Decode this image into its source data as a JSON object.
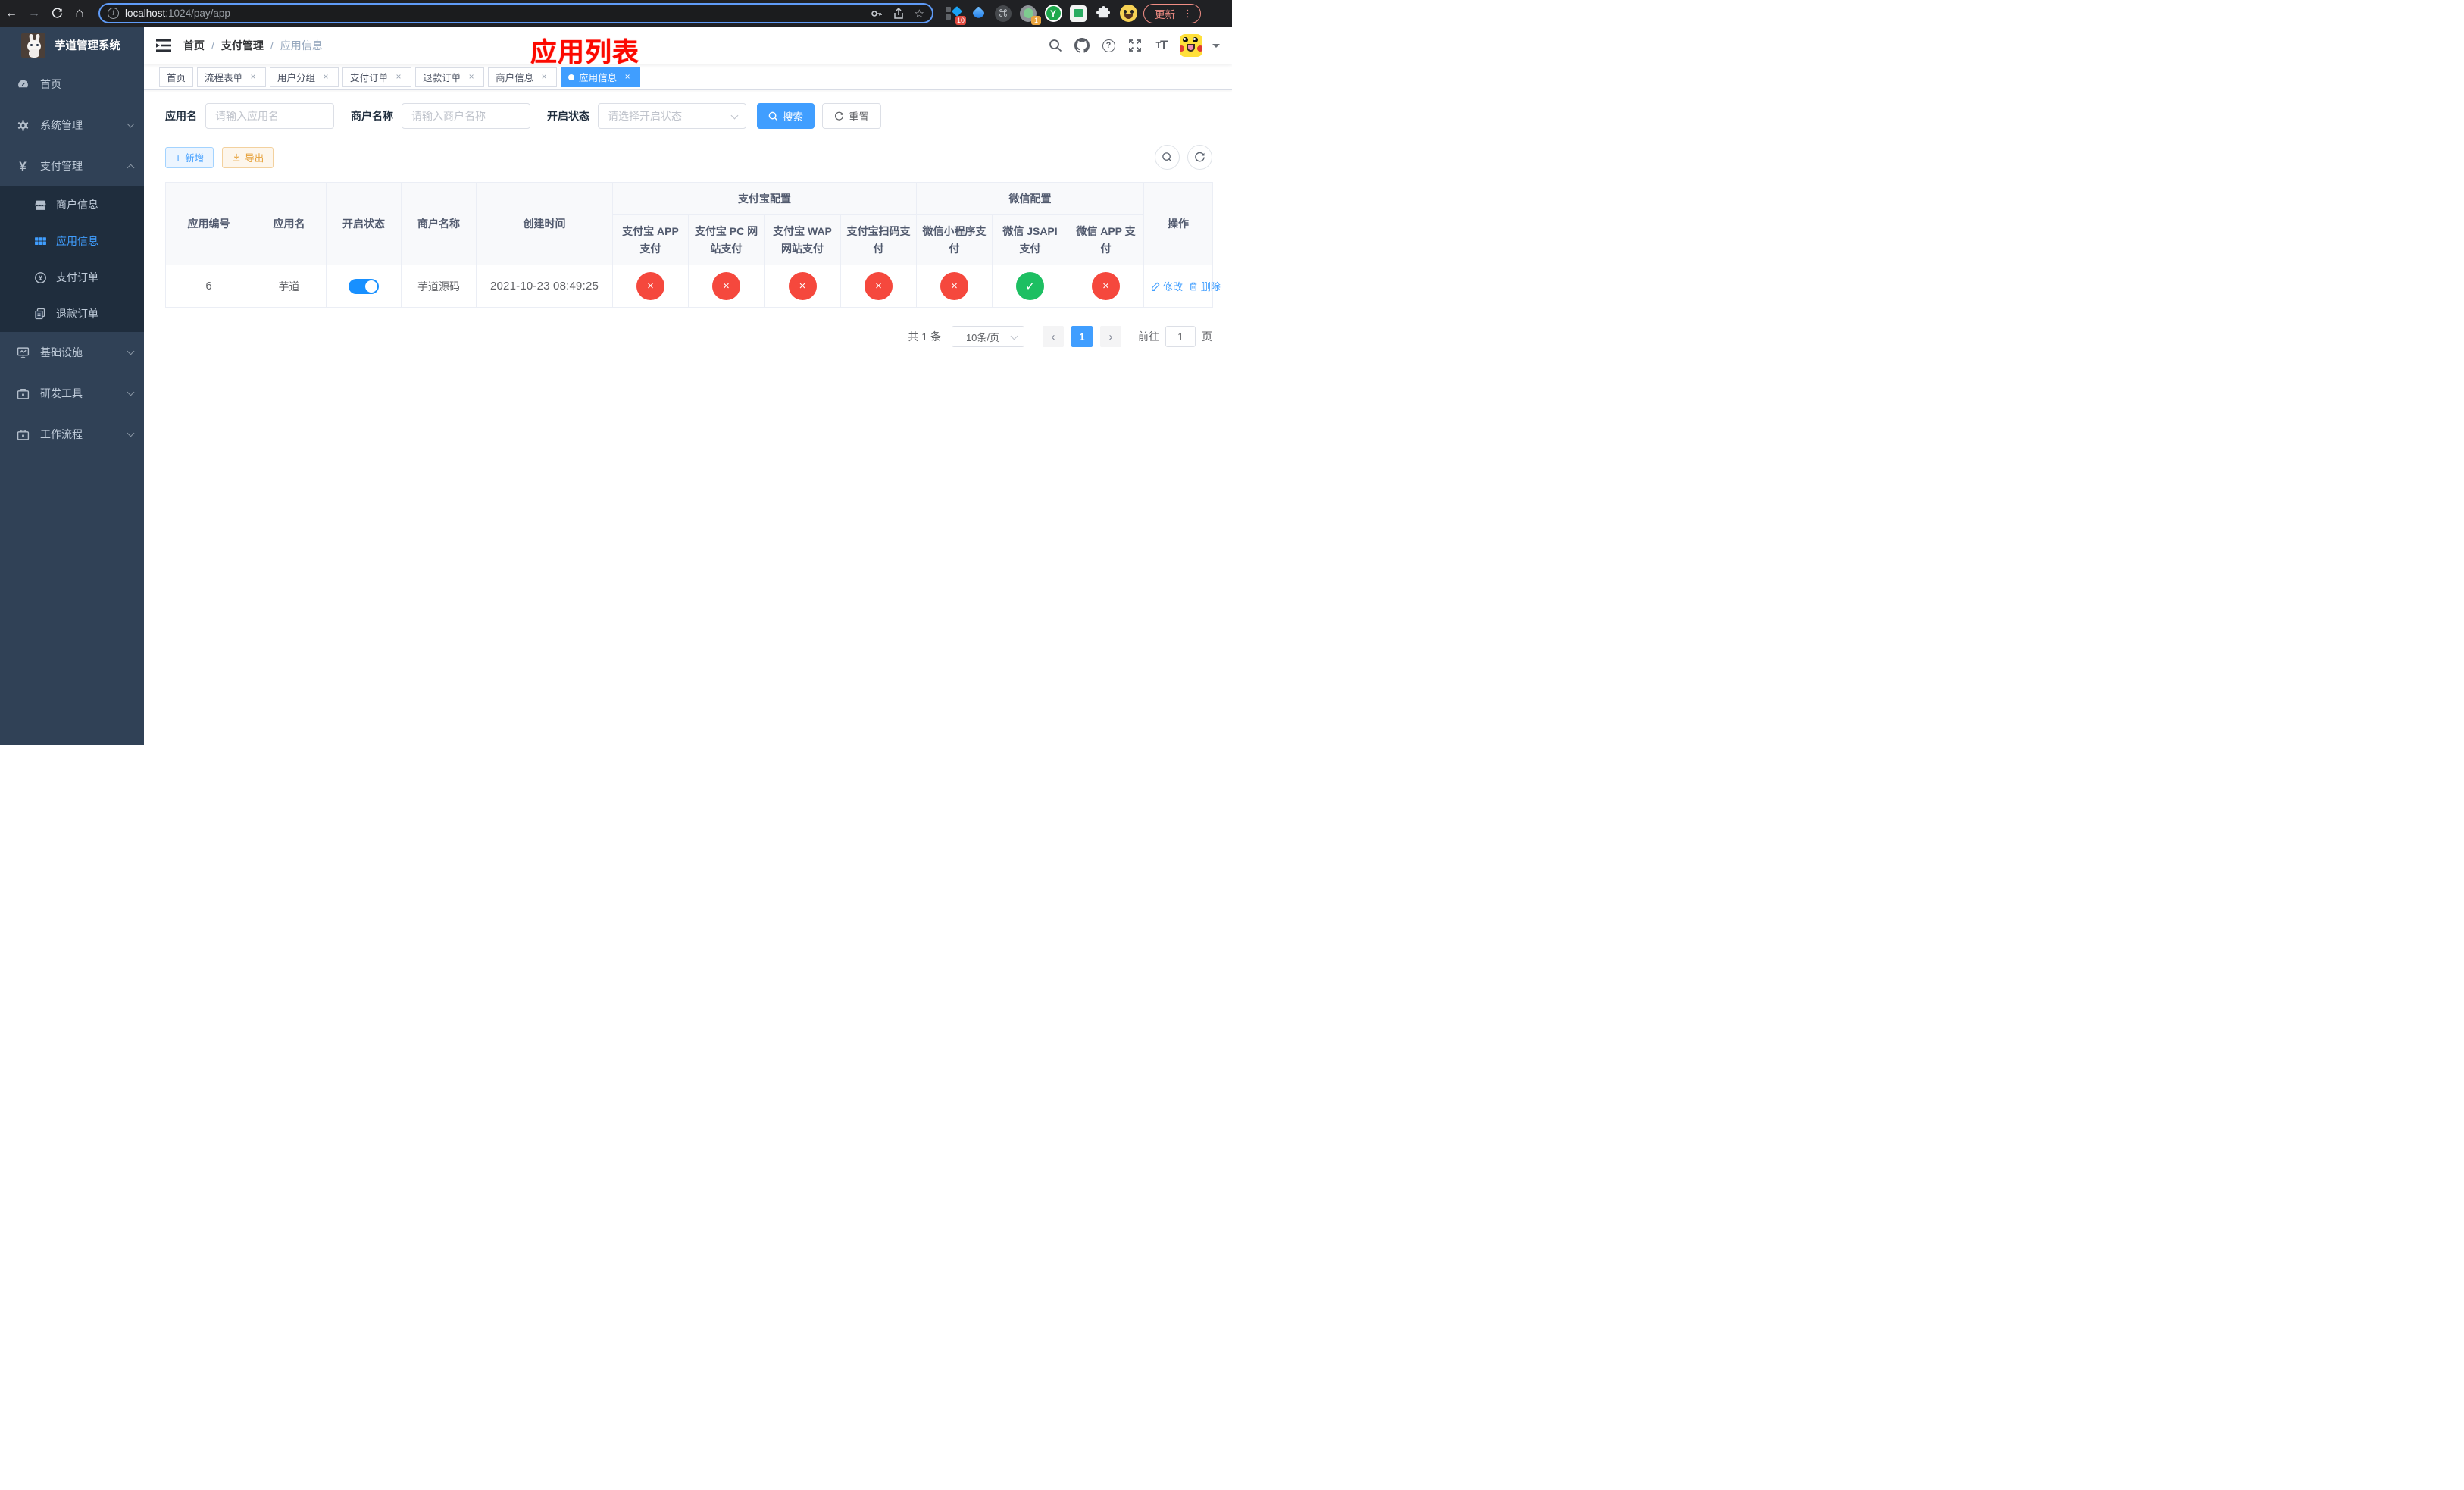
{
  "browser": {
    "url_host": "localhost",
    "url_rest": ":1024/pay/app",
    "update_label": "更新",
    "ext_badge_blocks": "10",
    "ext_badge_ring": "1",
    "ext_y_label": "Y"
  },
  "sidebar": {
    "title": "芋道管理系统",
    "menu_top": [
      {
        "label": "首页",
        "icon": "dashboard-icon"
      },
      {
        "label": "系统管理",
        "icon": "gear-icon"
      },
      {
        "label": "支付管理",
        "icon": "yen-icon"
      }
    ],
    "submenu": [
      {
        "label": "商户信息",
        "icon": "shop-icon",
        "active": false
      },
      {
        "label": "应用信息",
        "icon": "grid-icon",
        "active": true
      },
      {
        "label": "支付订单",
        "icon": "pay-order-icon",
        "active": false
      },
      {
        "label": "退款订单",
        "icon": "refund-icon",
        "active": false
      }
    ],
    "menu_bottom": [
      {
        "label": "基础设施",
        "icon": "infra-icon"
      },
      {
        "label": "研发工具",
        "icon": "tools-icon"
      },
      {
        "label": "工作流程",
        "icon": "workflow-icon"
      }
    ]
  },
  "navbar": {
    "breadcrumb": [
      "首页",
      "支付管理",
      "应用信息"
    ],
    "overlay_title": "应用列表"
  },
  "tags": [
    {
      "label": "首页"
    },
    {
      "label": "流程表单"
    },
    {
      "label": "用户分组"
    },
    {
      "label": "支付订单"
    },
    {
      "label": "退款订单"
    },
    {
      "label": "商户信息"
    },
    {
      "label": "应用信息"
    }
  ],
  "filters": {
    "app_name_label": "应用名",
    "app_name_placeholder": "请输入应用名",
    "merchant_label": "商户名称",
    "merchant_placeholder": "请输入商户名称",
    "status_label": "开启状态",
    "status_placeholder": "请选择开启状态",
    "search_label": "搜索",
    "reset_label": "重置"
  },
  "toolbar": {
    "add_label": "新增",
    "export_label": "导出"
  },
  "table": {
    "group_headers": [
      {
        "label": "支付宝配置",
        "colspan": 4
      },
      {
        "label": "微信配置",
        "colspan": 3
      }
    ],
    "columns": [
      "应用编号",
      "应用名",
      "开启状态",
      "商户名称",
      "创建时间",
      "支付宝 APP 支付",
      "支付宝 PC 网站支付",
      "支付宝 WAP 网站支付",
      "支付宝扫码支付",
      "微信小程序支付",
      "微信 JSAPI 支付",
      "微信 APP 支付",
      "操作"
    ],
    "row": {
      "id": "6",
      "name": "芋道",
      "enabled": true,
      "merchant": "芋道源码",
      "created": "2021-10-23 08:49:25",
      "statuses": [
        "no",
        "no",
        "no",
        "no",
        "no",
        "yes",
        "no"
      ],
      "edit_label": "修改",
      "delete_label": "删除"
    }
  },
  "pagination": {
    "total": "共 1 条",
    "page_size": "10条/页",
    "current_page": "1",
    "goto_label": "前往",
    "goto_value": "1",
    "page_suffix": "页"
  },
  "icons": {
    "back": "←",
    "forward": "→",
    "home": "⌂",
    "star": "☆",
    "cmd": "⌘",
    "info": "i",
    "dots": "⋮",
    "close": "×",
    "plus": "+",
    "yen": "¥",
    "question": "?",
    "check": "✓",
    "cross": "×",
    "prev": "‹",
    "next": "›",
    "sep": "/",
    "tt_small": "T",
    "tt_big": "T"
  },
  "colors": {
    "primary": "#409eff",
    "success": "#1dbf62",
    "danger": "#f5483d",
    "sidebar_bg": "#304156",
    "submenu_bg": "#1f2d3d",
    "active_tag": "#409eff"
  }
}
